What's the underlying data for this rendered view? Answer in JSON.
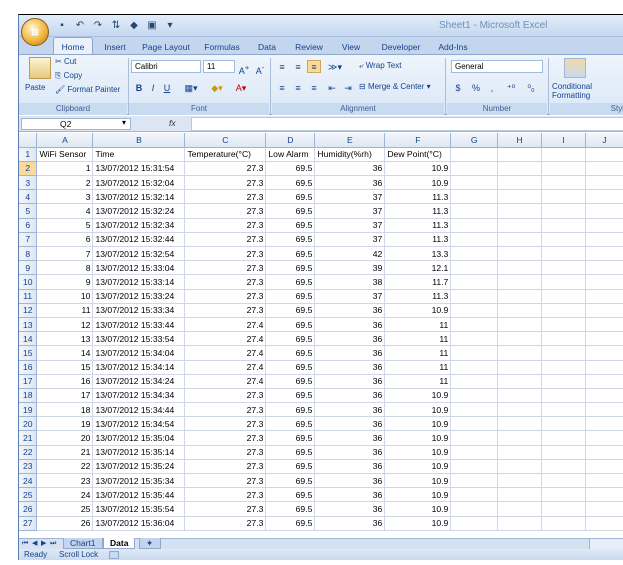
{
  "window_title": "Sheet1 - Microsoft Excel",
  "ribbon_tabs": [
    "Home",
    "Insert",
    "Page Layout",
    "Formulas",
    "Data",
    "Review",
    "View",
    "Developer",
    "Add-Ins"
  ],
  "clipboard": {
    "paste": "Paste",
    "cut": "Cut",
    "copy": "Copy",
    "format_painter": "Format Painter",
    "label": "Clipboard"
  },
  "font": {
    "name": "Calibri",
    "size": "11",
    "label": "Font",
    "bold": "B",
    "italic": "I",
    "underline": "U"
  },
  "alignment": {
    "wrap_text": "Wrap Text",
    "merge_center": "Merge & Center",
    "label": "Alignment"
  },
  "number": {
    "format": "General",
    "label": "Number",
    "currency": "$",
    "percent": "%"
  },
  "styles": {
    "conditional_formatting": "Conditional Formatting",
    "label": "Styl"
  },
  "formula_bar": {
    "name_box": "Q2",
    "fx": "fx",
    "value": ""
  },
  "columns": [
    "A",
    "B",
    "C",
    "D",
    "E",
    "F",
    "G",
    "H",
    "I",
    "J"
  ],
  "header_row": [
    "WiFi Sensor",
    "Time",
    "Temperature(°C)",
    "Low Alarm",
    "Humidity(%rh)",
    "Dew Point(°C)"
  ],
  "rows": [
    [
      "1",
      "13/07/2012 15:31:54",
      "27.3",
      "69.5",
      "36",
      "10.9"
    ],
    [
      "2",
      "13/07/2012 15:32:04",
      "27.3",
      "69.5",
      "36",
      "10.9"
    ],
    [
      "3",
      "13/07/2012 15:32:14",
      "27.3",
      "69.5",
      "37",
      "11.3"
    ],
    [
      "4",
      "13/07/2012 15:32:24",
      "27.3",
      "69.5",
      "37",
      "11.3"
    ],
    [
      "5",
      "13/07/2012 15:32:34",
      "27.3",
      "69.5",
      "37",
      "11.3"
    ],
    [
      "6",
      "13/07/2012 15:32:44",
      "27.3",
      "69.5",
      "37",
      "11.3"
    ],
    [
      "7",
      "13/07/2012 15:32:54",
      "27.3",
      "69.5",
      "42",
      "13.3"
    ],
    [
      "8",
      "13/07/2012 15:33:04",
      "27.3",
      "69.5",
      "39",
      "12.1"
    ],
    [
      "9",
      "13/07/2012 15:33:14",
      "27.3",
      "69.5",
      "38",
      "11.7"
    ],
    [
      "10",
      "13/07/2012 15:33:24",
      "27.3",
      "69.5",
      "37",
      "11.3"
    ],
    [
      "11",
      "13/07/2012 15:33:34",
      "27.3",
      "69.5",
      "36",
      "10.9"
    ],
    [
      "12",
      "13/07/2012 15:33:44",
      "27.4",
      "69.5",
      "36",
      "11"
    ],
    [
      "13",
      "13/07/2012 15:33:54",
      "27.4",
      "69.5",
      "36",
      "11"
    ],
    [
      "14",
      "13/07/2012 15:34:04",
      "27.4",
      "69.5",
      "36",
      "11"
    ],
    [
      "15",
      "13/07/2012 15:34:14",
      "27.4",
      "69.5",
      "36",
      "11"
    ],
    [
      "16",
      "13/07/2012 15:34:24",
      "27.4",
      "69.5",
      "36",
      "11"
    ],
    [
      "17",
      "13/07/2012 15:34:34",
      "27.3",
      "69.5",
      "36",
      "10.9"
    ],
    [
      "18",
      "13/07/2012 15:34:44",
      "27.3",
      "69.5",
      "36",
      "10.9"
    ],
    [
      "19",
      "13/07/2012 15:34:54",
      "27.3",
      "69.5",
      "36",
      "10.9"
    ],
    [
      "20",
      "13/07/2012 15:35:04",
      "27.3",
      "69.5",
      "36",
      "10.9"
    ],
    [
      "21",
      "13/07/2012 15:35:14",
      "27.3",
      "69.5",
      "36",
      "10.9"
    ],
    [
      "22",
      "13/07/2012 15:35:24",
      "27.3",
      "69.5",
      "36",
      "10.9"
    ],
    [
      "23",
      "13/07/2012 15:35:34",
      "27.3",
      "69.5",
      "36",
      "10.9"
    ],
    [
      "24",
      "13/07/2012 15:35:44",
      "27.3",
      "69.5",
      "36",
      "10.9"
    ],
    [
      "25",
      "13/07/2012 15:35:54",
      "27.3",
      "69.5",
      "36",
      "10.9"
    ],
    [
      "26",
      "13/07/2012 15:36:04",
      "27.3",
      "69.5",
      "36",
      "10.9"
    ]
  ],
  "sheet_tabs": [
    "Chart1",
    "Data"
  ],
  "active_sheet": "Data",
  "status": {
    "mode": "Ready",
    "scroll_lock": "Scroll Lock"
  },
  "colors": {
    "ribbon_bg": "#dbe8f7",
    "selection": "#f9d99c",
    "accent": "#15428b"
  }
}
